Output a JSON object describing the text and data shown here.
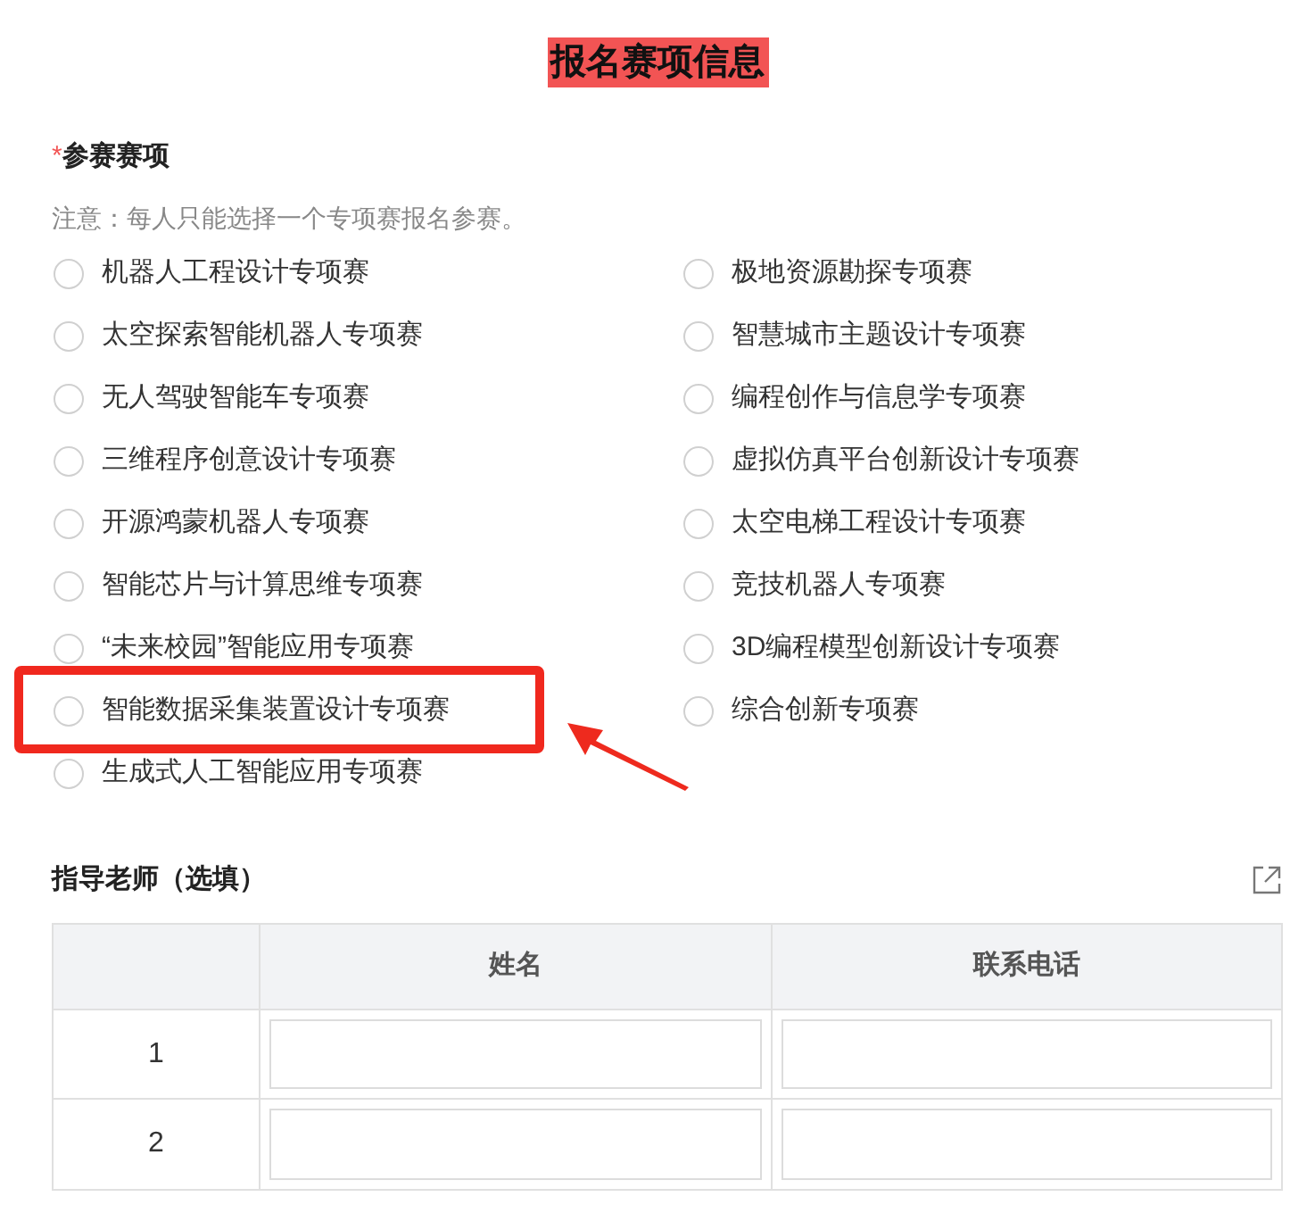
{
  "title": "报名赛项信息",
  "field": {
    "label": "参赛赛项",
    "required_mark": "*",
    "note": "注意：每人只能选择一个专项赛报名参赛。"
  },
  "option_columns": [
    [
      {
        "label": "机器人工程设计专项赛",
        "selected": false,
        "highlighted": false
      },
      {
        "label": "太空探索智能机器人专项赛",
        "selected": false,
        "highlighted": false
      },
      {
        "label": "无人驾驶智能车专项赛",
        "selected": false,
        "highlighted": false
      },
      {
        "label": "三维程序创意设计专项赛",
        "selected": false,
        "highlighted": false
      },
      {
        "label": "开源鸿蒙机器人专项赛",
        "selected": false,
        "highlighted": false
      },
      {
        "label": "智能芯片与计算思维专项赛",
        "selected": false,
        "highlighted": false
      },
      {
        "label": "“未来校园”智能应用专项赛",
        "selected": false,
        "highlighted": false
      },
      {
        "label": "智能数据采集装置设计专项赛",
        "selected": false,
        "highlighted": true
      },
      {
        "label": "生成式人工智能应用专项赛",
        "selected": false,
        "highlighted": false
      }
    ],
    [
      {
        "label": "极地资源勘探专项赛",
        "selected": false,
        "highlighted": false
      },
      {
        "label": "智慧城市主题设计专项赛",
        "selected": false,
        "highlighted": false
      },
      {
        "label": "编程创作与信息学专项赛",
        "selected": false,
        "highlighted": false
      },
      {
        "label": "虚拟仿真平台创新设计专项赛",
        "selected": false,
        "highlighted": false
      },
      {
        "label": "太空电梯工程设计专项赛",
        "selected": false,
        "highlighted": false
      },
      {
        "label": "竞技机器人专项赛",
        "selected": false,
        "highlighted": false
      },
      {
        "label": "3D编程模型创新设计专项赛",
        "selected": false,
        "highlighted": false
      },
      {
        "label": "综合创新专项赛",
        "selected": false,
        "highlighted": false
      }
    ]
  ],
  "teachers": {
    "label": "指导老师（选填）",
    "columns": [
      "姓名",
      "联系电话"
    ],
    "rows": [
      {
        "index": "1"
      },
      {
        "index": "2"
      }
    ]
  }
}
